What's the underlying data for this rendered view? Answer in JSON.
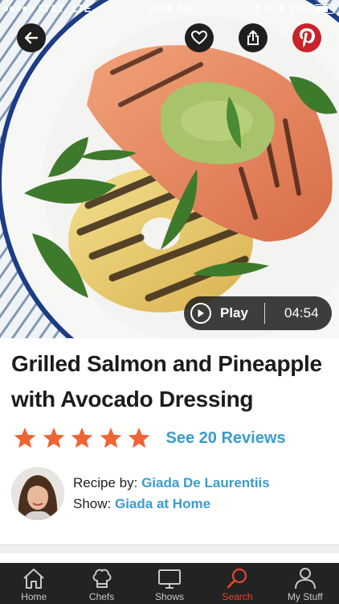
{
  "status": {
    "carrier": "AT&T",
    "network": "LTE",
    "time": "11:36 AM",
    "battery": "73%"
  },
  "hero": {
    "icons": [
      "back-arrow-icon",
      "heart-icon",
      "share-icon",
      "pinterest-icon"
    ],
    "play_label": "Play",
    "duration": "04:54"
  },
  "recipe": {
    "title": "Grilled Salmon and Pineapple with Avocado Dressing",
    "rating": 5,
    "reviews_link": "See 20 Reviews"
  },
  "chef": {
    "recipe_by_label": "Recipe by:",
    "recipe_by_name": "Giada De Laurentiis",
    "show_label": "Show:",
    "show_name": "Giada at Home"
  },
  "tabs": [
    {
      "label": "Home",
      "icon": "home-icon"
    },
    {
      "label": "Chefs",
      "icon": "chef-hat-icon"
    },
    {
      "label": "Shows",
      "icon": "tv-icon"
    },
    {
      "label": "Search",
      "icon": "search-icon",
      "active": true
    },
    {
      "label": "My Stuff",
      "icon": "person-icon"
    }
  ],
  "colors": {
    "accent": "#3c9bd0",
    "star": "#ef6433",
    "active_tab": "#e8452c",
    "tabbar": "#232323"
  }
}
